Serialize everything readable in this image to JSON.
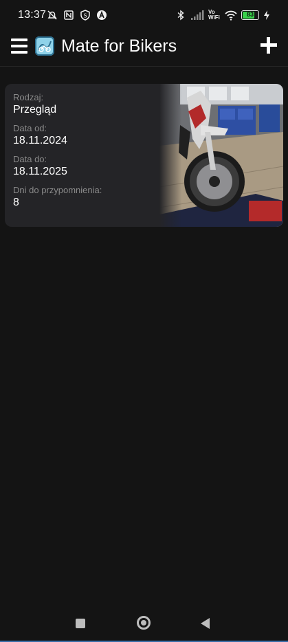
{
  "status_bar": {
    "time": "13:37",
    "battery_level": "83",
    "battery_fraction": 0.83,
    "left_icons": [
      "alarm-off-icon",
      "nfc-icon",
      "shield-icon",
      "a-circle-icon"
    ],
    "right_icons": [
      "bluetooth-icon",
      "cellular-signal-icon",
      "vowifi-icon",
      "wifi-icon",
      "battery-icon",
      "charging-icon"
    ],
    "vowifi_text": "Vo WiFi"
  },
  "app_bar": {
    "title": "Mate for Bikers",
    "menu_icon": "hamburger-menu-icon",
    "add_icon": "plus-icon",
    "logo": "app-logo-icon"
  },
  "reminders": [
    {
      "type_label": "Rodzaj:",
      "type_value": "Przegląd",
      "date_from_label": "Data od:",
      "date_from_value": "18.11.2024",
      "date_to_label": "Data do:",
      "date_to_value": "18.11.2025",
      "days_label": "Dni do przypomnienia:",
      "days_value": "8",
      "image": "motorcycle-in-workshop-photo"
    }
  ],
  "nav_bar": {
    "recents_icon": "square-icon",
    "home_icon": "circle-icon",
    "back_icon": "triangle-back-icon"
  },
  "colors": {
    "background": "#141414",
    "card": "#242427",
    "label": "#8a8a8a",
    "text": "#ffffff",
    "battery": "#39d24a"
  }
}
